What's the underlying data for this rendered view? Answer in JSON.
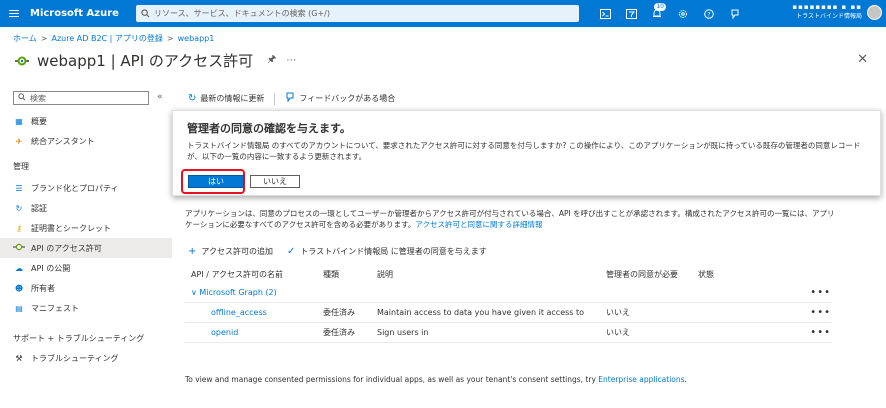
{
  "topbar": {
    "brand": "Microsoft Azure",
    "search_placeholder": "リソース、サービス、ドキュメントの検索 (G+/)",
    "notification_count": "10",
    "account_name": "▪▪▪▪▪▪▪▪ ▪ ▪▪",
    "account_org": "トラストバインド情報局",
    "icons": [
      "cloud-shell-icon",
      "directory-filter-icon",
      "bell-icon",
      "gear-icon",
      "help-icon",
      "feedback-icon"
    ]
  },
  "breadcrumb": [
    "ホーム",
    "Azure AD B2C | アプリの登録",
    "webapp1"
  ],
  "page": {
    "title": "webapp1 | API のアクセス許可"
  },
  "sidebar": {
    "search_placeholder": "検索",
    "items_top": [
      {
        "label": "概要",
        "icon": "grid-icon"
      },
      {
        "label": "統合アシスタント",
        "icon": "rocket-icon"
      }
    ],
    "section_manage": "管理",
    "items_manage": [
      {
        "label": "ブランド化とプロパティ",
        "icon": "branding-icon"
      },
      {
        "label": "認証",
        "icon": "auth-icon"
      },
      {
        "label": "証明書とシークレット",
        "icon": "key-icon"
      },
      {
        "label": "API のアクセス許可",
        "icon": "api-permissions-icon"
      },
      {
        "label": "API の公開",
        "icon": "cloud-icon"
      },
      {
        "label": "所有者",
        "icon": "people-icon"
      },
      {
        "label": "マニフェスト",
        "icon": "manifest-icon"
      }
    ],
    "section_support": "サポート + トラブルシューティング",
    "items_support": [
      {
        "label": "トラブルシューティング",
        "icon": "wrench-icon"
      }
    ]
  },
  "toolbar": {
    "refresh_label": "最新の情報に更新",
    "feedback_label": "フィードバックがある場合"
  },
  "dialog": {
    "title": "管理者の同意の確認を与えます。",
    "body": "トラストバインド情報局 のすべてのアカウントについて、要求されたアクセス許可に対する同意を付与しますか? この操作により、このアプリケーションが既に持っている既存の管理者の同意レコードが、以下の一覧の内容に一致するよう更新されます。",
    "yes_label": "はい",
    "no_label": "いいえ"
  },
  "info": {
    "text": "アプリケーションは、同意のプロセスの一環としてユーザーか管理者からアクセス許可が付与されている場合、API を呼び出すことが承認されます。構成されたアクセス許可の一覧には、アプリケーションに必要なすべてのアクセス許可を含める必要があります。",
    "link": "アクセス許可と同意に関する詳細情報"
  },
  "actions": {
    "add_permission": "アクセス許可の追加",
    "grant_consent": "トラストバインド情報局 に管理者の同意を与えます"
  },
  "table": {
    "headers": [
      "API / アクセス許可の名前",
      "種類",
      "説明",
      "管理者の同意が必要",
      "状態"
    ],
    "group_label": "Microsoft Graph (2)",
    "rows": [
      {
        "name": "offline_access",
        "type": "委任済み",
        "description": "Maintain access to data you have given it access to",
        "admin_consent": "いいえ",
        "status": ""
      },
      {
        "name": "openid",
        "type": "委任済み",
        "description": "Sign users in",
        "admin_consent": "いいえ",
        "status": ""
      }
    ]
  },
  "footer": {
    "text": "To view and manage consented permissions for individual apps, as well as your tenant's consent settings, try",
    "link": "Enterprise applications",
    "end": "."
  },
  "colors": {
    "accent": "#0078d4",
    "highlight": "#e81123"
  }
}
